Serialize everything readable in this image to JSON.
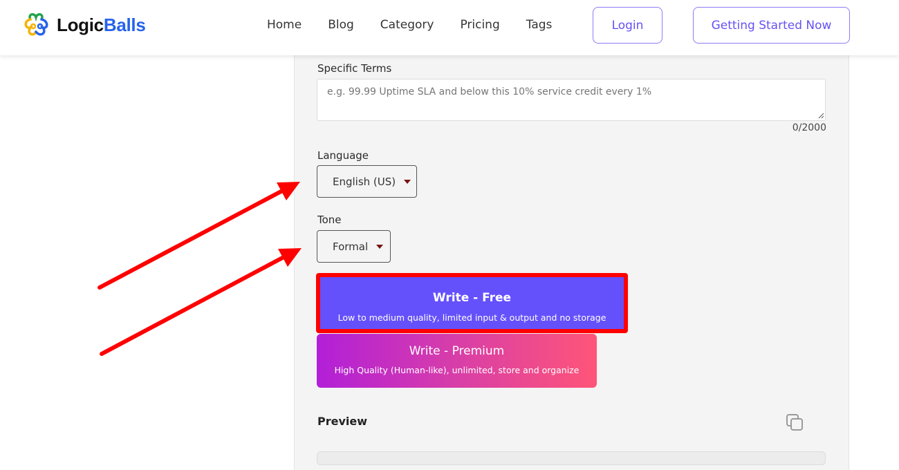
{
  "header": {
    "logo": {
      "part1": "Logic",
      "part2": "Balls",
      "icon": "logicballs-logo-icon"
    },
    "nav": [
      {
        "label": "Home"
      },
      {
        "label": "Blog"
      },
      {
        "label": "Category"
      },
      {
        "label": "Pricing"
      },
      {
        "label": "Tags"
      }
    ],
    "login_label": "Login",
    "start_label": "Getting Started Now"
  },
  "form": {
    "specific_terms": {
      "label": "Specific Terms",
      "value": "",
      "placeholder": "e.g. 99.99 Uptime SLA and below this 10% service credit every 1%",
      "counter": "0/2000"
    },
    "language": {
      "label": "Language",
      "selected": "English (US)"
    },
    "tone": {
      "label": "Tone",
      "selected": "Formal"
    },
    "write_free": {
      "title": "Write - Free",
      "subtitle": "Low to medium quality, limited input & output and no storage"
    },
    "write_premium": {
      "title": "Write - Premium",
      "subtitle": "High Quality (Human-like), unlimited, store and organize"
    }
  },
  "preview": {
    "title": "Preview",
    "copy_icon": "copy-icon"
  },
  "colors": {
    "brand_purple": "#6551fc",
    "outline_purple": "#8b7cf7",
    "annotation_red": "#ff0000",
    "premium_gradient_start": "#b21fd8",
    "premium_gradient_end": "#ff5578",
    "logo_blue": "#2563eb"
  }
}
